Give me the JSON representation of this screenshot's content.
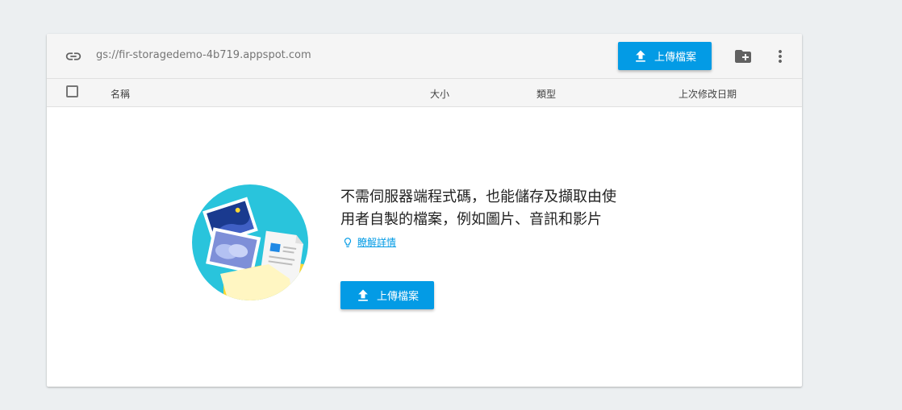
{
  "toolbar": {
    "bucket_path": "gs://fir-storagedemo-4b719.appspot.com",
    "upload_label": "上傳檔案",
    "icons": [
      "link-icon",
      "upload-icon",
      "create-folder-icon",
      "more-vert-icon"
    ]
  },
  "table": {
    "headers": {
      "name": "名稱",
      "size": "大小",
      "type": "類型",
      "modified": "上次修改日期"
    }
  },
  "empty_state": {
    "line1": "不需伺服器端程式碼，也能儲存及擷取由使",
    "line2": "用者自製的檔案，例如圖片、音訊和影片",
    "learn_more": "瞭解詳情",
    "upload_label": "上傳檔案"
  },
  "colors": {
    "accent": "#039be5",
    "illustration_bg": "#29c4dc"
  }
}
